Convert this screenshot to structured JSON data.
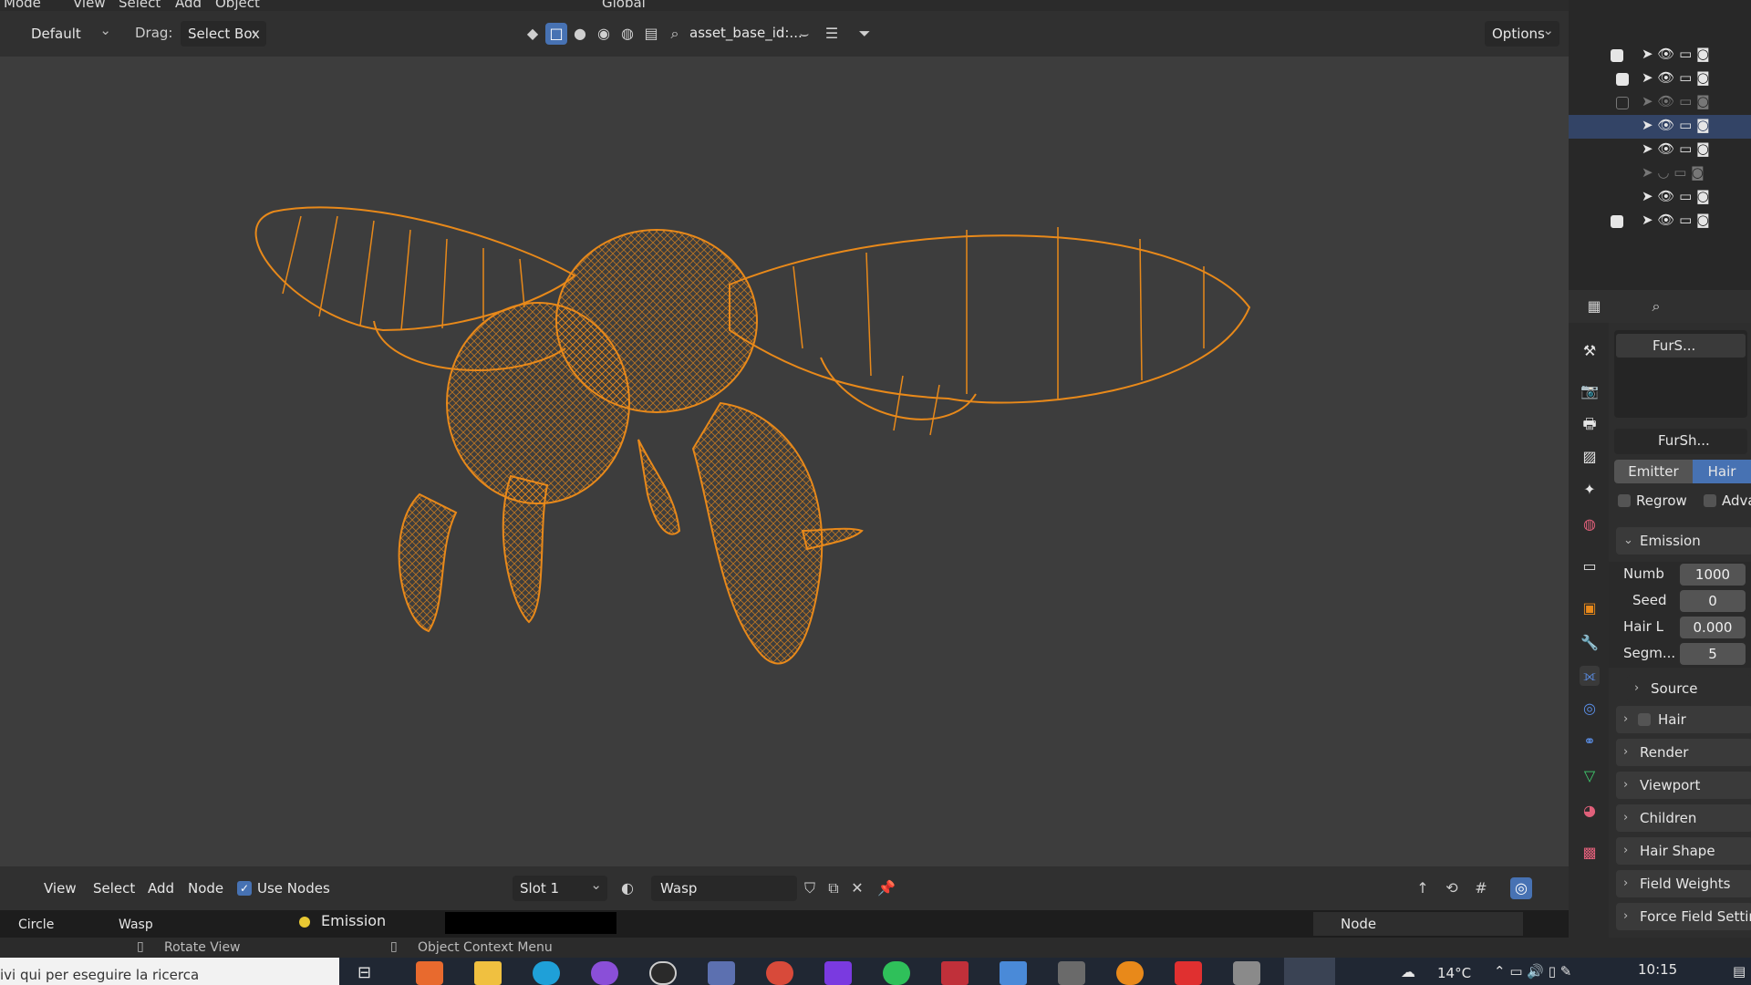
{
  "top_menu": {
    "items": [
      "Mode",
      "View",
      "Select",
      "Add",
      "Object"
    ],
    "transform_orientation": "Global"
  },
  "tool_header": {
    "mode": "Default",
    "drag_label": "Drag:",
    "drag_value": "Select Box",
    "asset_field": "asset_base_id:...",
    "options_label": "Options"
  },
  "node_header": {
    "menu": [
      "View",
      "Select",
      "Add",
      "Node"
    ],
    "use_nodes_label": "Use Nodes",
    "slot": "Slot 1",
    "material": "Wasp",
    "breadcrumb_object": "Circle",
    "breadcrumb_material": "Wasp",
    "emission_label": "Emission",
    "node_panel": "Node"
  },
  "status_bar": {
    "left_hint": "Rotate View",
    "right_hint": "Object Context Menu"
  },
  "taskbar": {
    "search_placeholder": "ivi qui per eseguire la ricerca",
    "temperature": "14°C",
    "time": "10:15"
  },
  "properties": {
    "particle_system": "FurS...",
    "settings_name": "FurSh...",
    "type_buttons": [
      "Emitter",
      "Hair"
    ],
    "regrow_label": "Regrow",
    "advanced_label": "Adva",
    "emission_panel": "Emission",
    "fields": [
      {
        "label": "Numb",
        "value": "1000"
      },
      {
        "label": "Seed",
        "value": "0"
      },
      {
        "label": "Hair L",
        "value": "0.000"
      },
      {
        "label": "Segm...",
        "value": "5"
      }
    ],
    "source_panel": "Source",
    "panels": [
      "Hair Dynamics",
      "Render",
      "Viewport Display",
      "Children",
      "Hair Shape",
      "Field Weights",
      "Force Field Settings"
    ]
  },
  "colors": {
    "wireframe": "#e8891a",
    "accent": "#4772b3",
    "emission_dot": "#e8c833"
  }
}
